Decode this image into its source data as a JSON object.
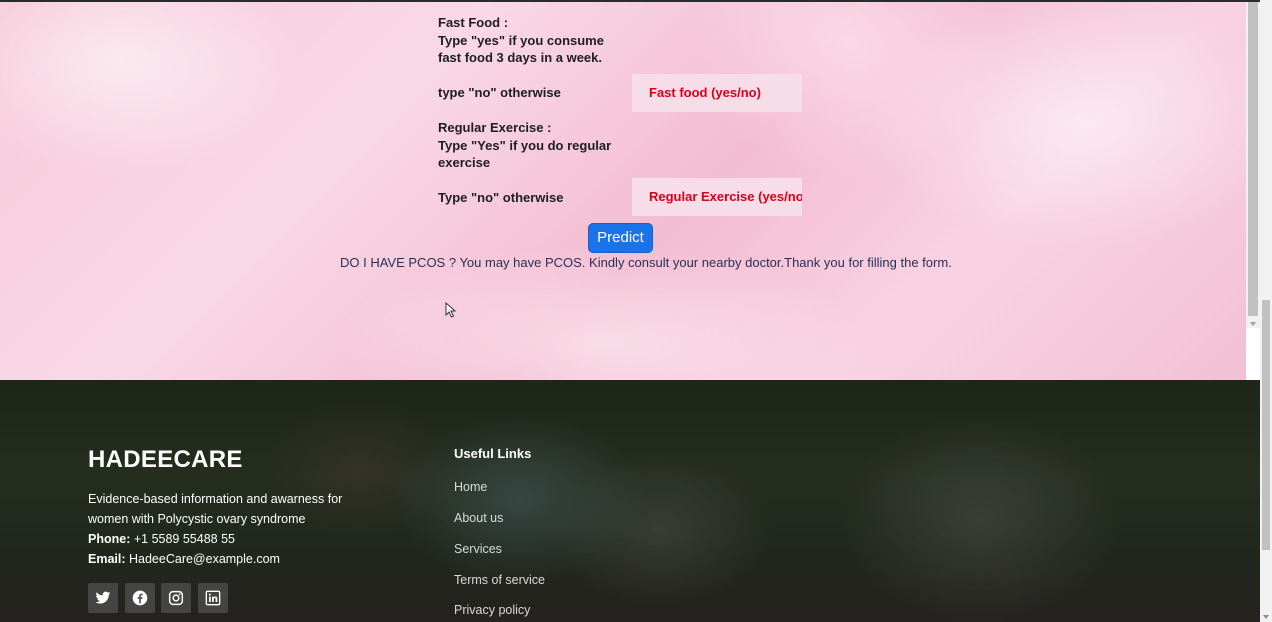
{
  "form": {
    "fast_food_label": "Fast Food :\nType \"yes\" if you consume fast food 3 days in a week.",
    "fast_food_otherwise": "type \"no\" otherwise",
    "fast_food_placeholder": "Fast food (yes/no)",
    "exercise_label": "Regular Exercise :\nType \"Yes\" if you do regular exercise",
    "exercise_otherwise": "Type \"no\" otherwise",
    "exercise_placeholder": "Regular Exercise (yes/no)",
    "predict_button": "Predict",
    "result_text": "DO I HAVE PCOS ? You may have PCOS. Kindly consult your nearby doctor.Thank you for filling the form."
  },
  "footer": {
    "brand": "HADEECARE",
    "description": "Evidence-based information and awarness for women with Polycystic ovary syndrome",
    "phone_label": "Phone:",
    "phone": "+1 5589 55488 55",
    "email_label": "Email:",
    "email": "HadeeCare@example.com",
    "social_icons": [
      "twitter-icon",
      "facebook-icon",
      "instagram-icon",
      "linkedin-icon"
    ],
    "useful_links_title": "Useful Links",
    "links": [
      "Home",
      "About us",
      "Services",
      "Terms of service",
      "Privacy policy"
    ]
  },
  "colors": {
    "input_text": "#d9001b",
    "predict_button_bg": "#1a73e8",
    "result_text": "#2a2f5a"
  }
}
